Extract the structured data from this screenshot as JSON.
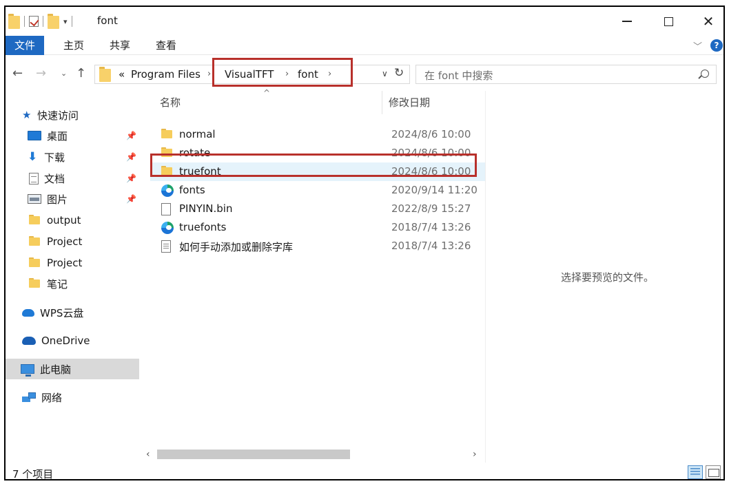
{
  "window": {
    "title": "font"
  },
  "ribbon": {
    "tabs": [
      {
        "label": "文件"
      },
      {
        "label": "主页"
      },
      {
        "label": "共享"
      },
      {
        "label": "查看"
      }
    ],
    "help_label": "?"
  },
  "address": {
    "overflow": "«",
    "crumbs": [
      "Program Files",
      "VisualTFT",
      "font"
    ]
  },
  "search": {
    "placeholder": "在 font 中搜索"
  },
  "sidebar": {
    "items": [
      {
        "label": "快速访问",
        "icon": "star-icon"
      },
      {
        "label": "桌面",
        "icon": "desktop-icon",
        "pinned": true
      },
      {
        "label": "下载",
        "icon": "download-icon",
        "pinned": true
      },
      {
        "label": "文档",
        "icon": "document-icon",
        "pinned": true
      },
      {
        "label": "图片",
        "icon": "pictures-icon",
        "pinned": true
      },
      {
        "label": "output",
        "icon": "folder-icon"
      },
      {
        "label": "Project",
        "icon": "folder-icon"
      },
      {
        "label": "Project",
        "icon": "folder-icon"
      },
      {
        "label": "笔记",
        "icon": "folder-icon"
      },
      {
        "label": "WPS云盘",
        "icon": "cloud-icon"
      },
      {
        "label": "OneDrive",
        "icon": "onedrive-icon"
      },
      {
        "label": "此电脑",
        "icon": "computer-icon",
        "selected": true
      },
      {
        "label": "网络",
        "icon": "network-icon"
      }
    ]
  },
  "columns": {
    "name": "名称",
    "date": "修改日期"
  },
  "files": [
    {
      "name": "normal",
      "date": "2024/8/6 10:00",
      "icon": "folder-icon"
    },
    {
      "name": "rotate",
      "date": "2024/8/6 10:00",
      "icon": "folder-icon"
    },
    {
      "name": "truefont",
      "date": "2024/8/6 10:00",
      "icon": "folder-icon",
      "highlighted": true
    },
    {
      "name": "fonts",
      "date": "2020/9/14 11:20",
      "icon": "edge-icon"
    },
    {
      "name": "PINYIN.bin",
      "date": "2022/8/9 15:27",
      "icon": "file-icon"
    },
    {
      "name": "truefonts",
      "date": "2018/7/4 13:26",
      "icon": "edge-icon"
    },
    {
      "name": "如何手动添加或删除字库",
      "date": "2018/7/4 13:26",
      "icon": "text-file-icon"
    }
  ],
  "preview": {
    "text": "选择要预览的文件。"
  },
  "status": {
    "text": "7 个项目"
  },
  "colors": {
    "accent": "#1e69c2",
    "highlight_box": "#b8302b",
    "hover_row": "#e5f3fb"
  }
}
